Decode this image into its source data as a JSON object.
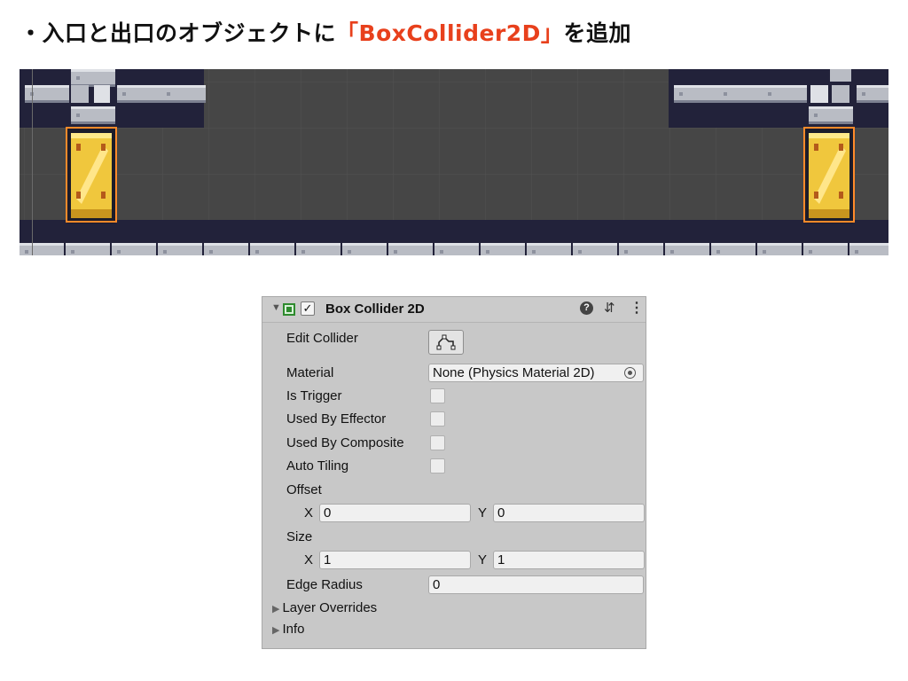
{
  "heading": {
    "prefix": "・入口と出口のオブジェクトに",
    "accent": "「BoxCollider2D」",
    "suffix": "を追加",
    "accent_color": "#e8401c"
  },
  "inspector": {
    "component_title": "Box Collider 2D",
    "enabled_check": "✓",
    "help_icon": "?",
    "preset_icon": "⇵",
    "menu_icon": "⋮",
    "fold_icon": "▼",
    "edit_collider_label": "Edit Collider",
    "material_label": "Material",
    "material_value": "None (Physics Material 2D)",
    "is_trigger_label": "Is Trigger",
    "used_by_effector_label": "Used By Effector",
    "used_by_composite_label": "Used By Composite",
    "auto_tiling_label": "Auto Tiling",
    "offset_label": "Offset",
    "offset_x_label": "X",
    "offset_x": "0",
    "offset_y_label": "Y",
    "offset_y": "0",
    "size_label": "Size",
    "size_x_label": "X",
    "size_x": "1",
    "size_y_label": "Y",
    "size_y": "1",
    "edge_radius_label": "Edge Radius",
    "edge_radius": "0",
    "layer_overrides_label": "Layer Overrides",
    "info_label": "Info",
    "collapsed_icon": "▶"
  },
  "checkboxes": {
    "is_trigger": false,
    "used_by_effector": false,
    "used_by_composite": false,
    "auto_tiling": false
  }
}
